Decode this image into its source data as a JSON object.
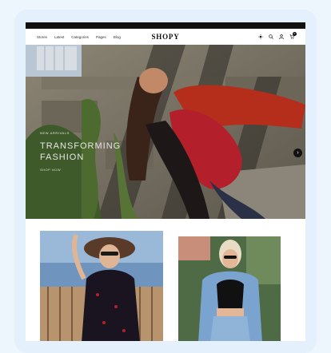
{
  "announcement": "",
  "nav": {
    "items": [
      "Stores",
      "Latest",
      "Categories",
      "Pages",
      "Blog"
    ]
  },
  "brand": {
    "logo": "SHOPY"
  },
  "header_icons": [
    "sun-icon",
    "search-icon",
    "user-icon",
    "cart-icon"
  ],
  "cart": {
    "count": "0"
  },
  "hero": {
    "eyebrow": "NEW ARRIVALS",
    "title": "TRANSFORMING FASHION",
    "link": "SHOP NOW"
  },
  "colors": {
    "text": "#111111",
    "accent_red": "#b3202b",
    "background": "#eef6fd"
  }
}
